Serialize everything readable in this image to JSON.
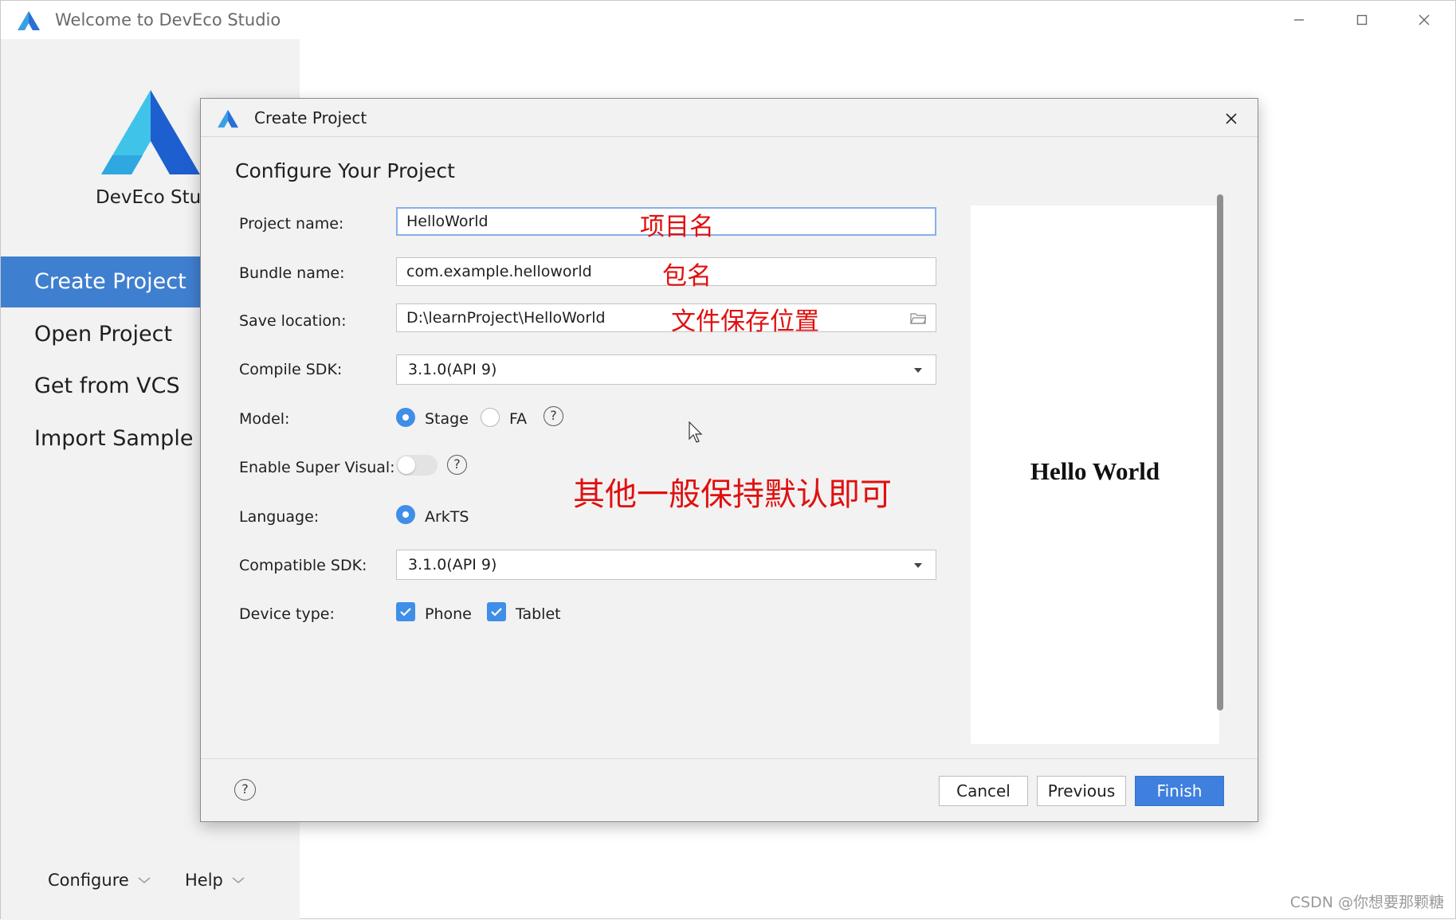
{
  "window": {
    "title": "Welcome to DevEco Studio"
  },
  "sidebar": {
    "app_name": "DevEco Studio",
    "items": [
      {
        "label": "Create Project",
        "active": true
      },
      {
        "label": "Open Project",
        "active": false
      },
      {
        "label": "Get from VCS",
        "active": false
      },
      {
        "label": "Import Sample",
        "active": false
      }
    ],
    "footer": {
      "configure_label": "Configure",
      "help_label": "Help"
    }
  },
  "dialog": {
    "title": "Create Project",
    "section_title": "Configure Your Project",
    "fields": {
      "project_name": {
        "label": "Project name:",
        "value": "HelloWorld",
        "annotation": "项目名"
      },
      "bundle_name": {
        "label": "Bundle name:",
        "value": "com.example.helloworld",
        "annotation": "包名"
      },
      "save_location": {
        "label": "Save location:",
        "value": "D:\\learnProject\\HelloWorld",
        "annotation": "文件保存位置"
      },
      "compile_sdk": {
        "label": "Compile SDK:",
        "value": "3.1.0(API 9)"
      },
      "model": {
        "label": "Model:",
        "options": [
          "Stage",
          "FA"
        ],
        "selected": "Stage"
      },
      "enable_super_visual": {
        "label": "Enable Super Visual:",
        "enabled": false
      },
      "language": {
        "label": "Language:",
        "options": [
          "ArkTS"
        ],
        "selected": "ArkTS"
      },
      "compatible_sdk": {
        "label": "Compatible SDK:",
        "value": "3.1.0(API 9)"
      },
      "device_type": {
        "label": "Device type:",
        "options": [
          "Phone",
          "Tablet"
        ],
        "checked": [
          "Phone",
          "Tablet"
        ]
      }
    },
    "annotation_defaults": "其他一般保持默认即可",
    "preview_text": "Hello World",
    "buttons": {
      "cancel": "Cancel",
      "previous": "Previous",
      "finish": "Finish"
    },
    "help_glyph": "?"
  },
  "watermark": "CSDN @你想要那颗糖",
  "colors": {
    "accent": "#3f7fcf",
    "primary_button": "#3f7fdd",
    "annotation": "#e01010",
    "checkbox": "#3f8ee8"
  }
}
